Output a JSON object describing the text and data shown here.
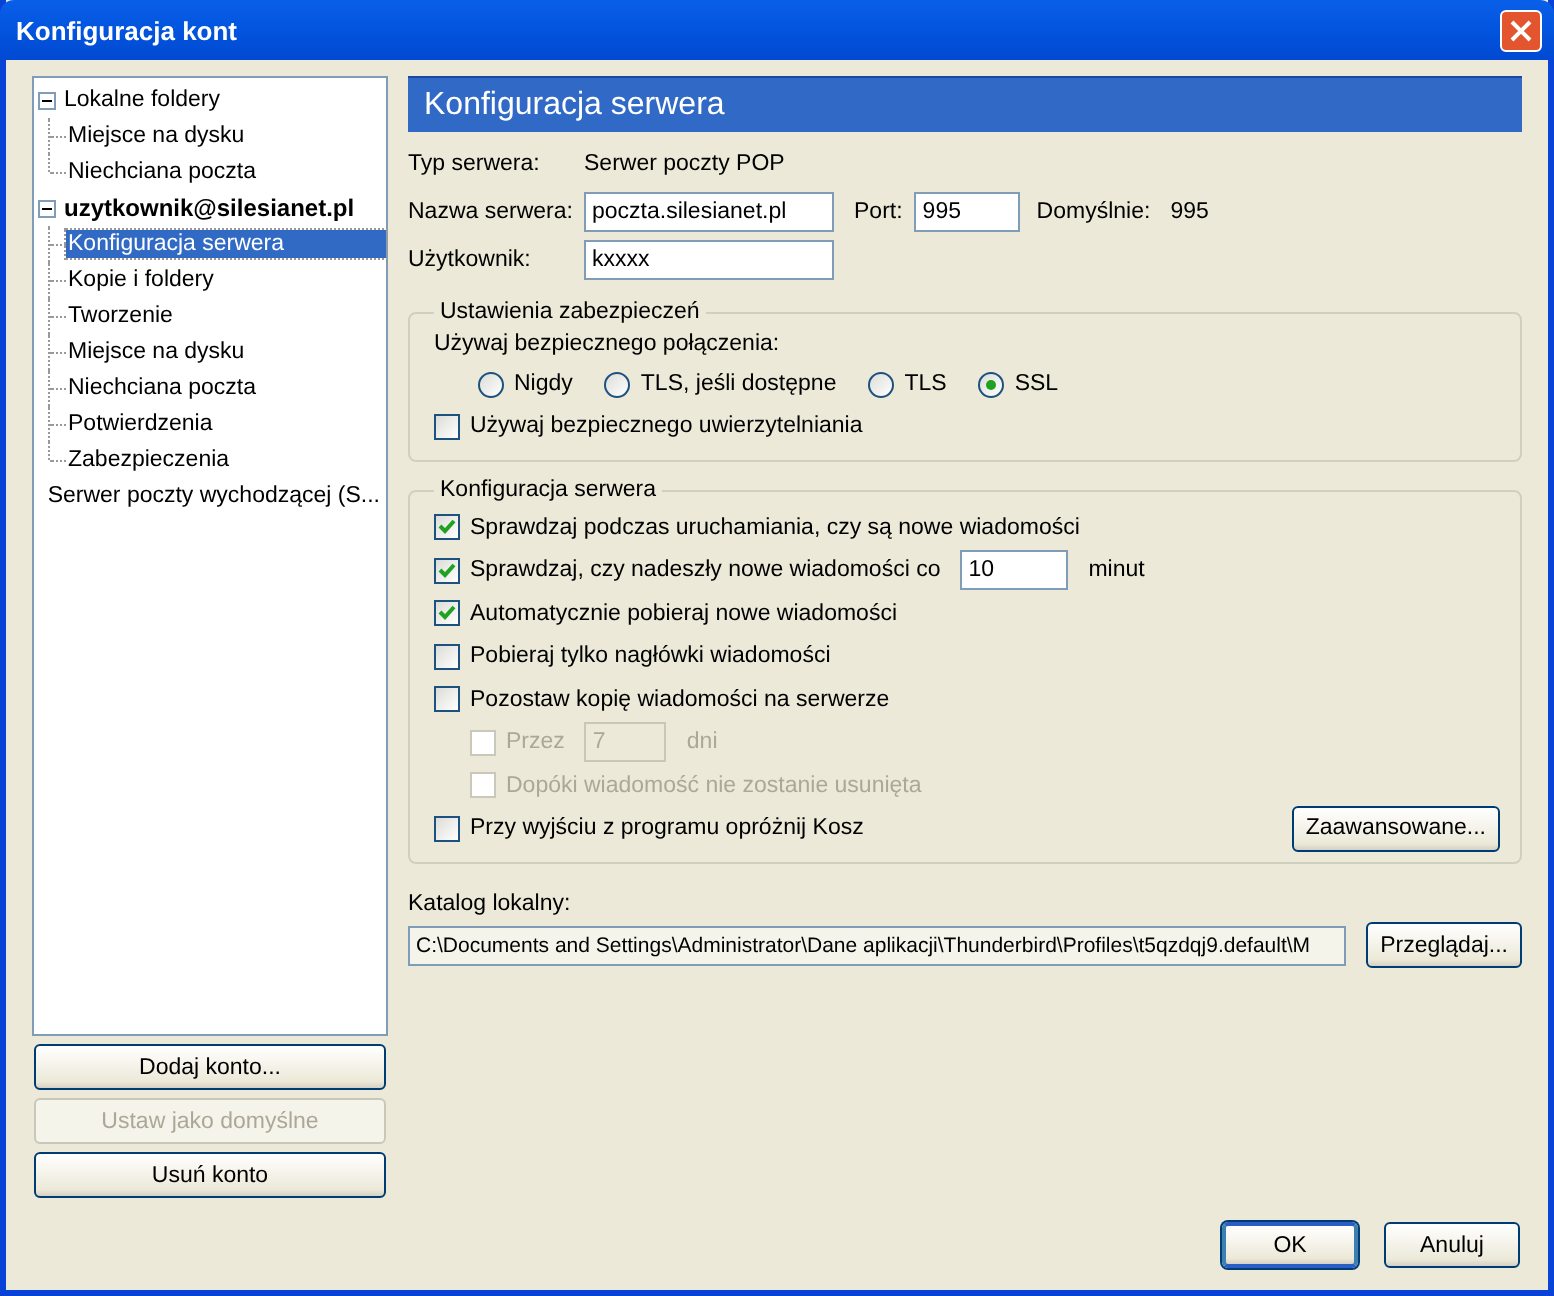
{
  "window": {
    "title": "Konfiguracja kont"
  },
  "tree": [
    {
      "label": "Lokalne foldery",
      "kind": "folder",
      "expanded": true,
      "selected": false,
      "children": [
        {
          "label": "Miejsce na dysku",
          "selected": false
        },
        {
          "label": "Niechciana poczta",
          "selected": false
        }
      ]
    },
    {
      "label": "uzytkownik@silesianet.pl",
      "kind": "account",
      "expanded": true,
      "selected": false,
      "children": [
        {
          "label": "Konfiguracja serwera",
          "selected": true
        },
        {
          "label": "Kopie i foldery",
          "selected": false
        },
        {
          "label": "Tworzenie",
          "selected": false
        },
        {
          "label": "Miejsce na dysku",
          "selected": false
        },
        {
          "label": "Niechciana poczta",
          "selected": false
        },
        {
          "label": "Potwierdzenia",
          "selected": false
        },
        {
          "label": "Zabezpieczenia",
          "selected": false
        }
      ]
    },
    {
      "label": "Serwer poczty wychodzącej (S...",
      "kind": "folder",
      "selected": false
    }
  ],
  "account_buttons": [
    {
      "label": "Dodaj konto...",
      "disabled": false
    },
    {
      "label": "Ustaw jako domyślne",
      "disabled": true
    },
    {
      "label": "Usuń konto",
      "disabled": false
    }
  ],
  "panel": {
    "title": "Konfiguracja serwera",
    "server_type": {
      "label": "Typ serwera:",
      "value": "Serwer poczty POP"
    },
    "server_name": {
      "label": "Nazwa serwera:",
      "value": "poczta.silesianet.pl"
    },
    "port": {
      "label": "Port:",
      "value": "995"
    },
    "default_port": {
      "label": "Domyślnie:",
      "value": "995"
    },
    "user": {
      "label": "Użytkownik:",
      "value": "kxxxx"
    },
    "security": {
      "title": "Ustawienia zabezpieczeń",
      "prompt": "Używaj bezpiecznego połączenia:",
      "radios": [
        {
          "label": "Nigdy",
          "selected": false
        },
        {
          "label": "TLS, jeśli dostępne",
          "selected": false
        },
        {
          "label": "TLS",
          "selected": false
        },
        {
          "label": "SSL",
          "selected": true
        }
      ],
      "secure_auth": {
        "label": "Używaj bezpiecznego uwierzytelniania",
        "checked": false
      }
    },
    "server": {
      "title": "Konfiguracja serwera",
      "options": [
        {
          "kind": "check",
          "label": "Sprawdzaj podczas uruchamiania, czy są nowe wiadomości",
          "checked": true,
          "disabled": false
        },
        {
          "kind": "interval",
          "label": "Sprawdzaj, czy nadeszły nowe wiadomości co",
          "checked": true,
          "disabled": false,
          "value": "10",
          "unit": "minut"
        },
        {
          "kind": "check",
          "label": "Automatycznie pobieraj nowe wiadomości",
          "checked": true,
          "disabled": false
        },
        {
          "kind": "check",
          "label": "Pobieraj tylko nagłówki wiadomości",
          "checked": false,
          "disabled": false
        },
        {
          "kind": "check",
          "label": "Pozostaw kopię wiadomości na serwerze",
          "checked": false,
          "disabled": false,
          "children": [
            {
              "kind": "interval",
              "label": "Przez",
              "checked": false,
              "disabled": true,
              "value": "7",
              "unit": "dni"
            },
            {
              "kind": "check",
              "label": "Dopóki wiadomość nie zostanie usunięta",
              "checked": false,
              "disabled": true
            }
          ]
        }
      ],
      "empty_trash": {
        "label": "Przy wyjściu z programu opróżnij Kosz",
        "checked": false
      },
      "advanced_button": "Zaawansowane..."
    },
    "local_dir": {
      "label": "Katalog lokalny:",
      "value": "C:\\Documents and Settings\\Administrator\\Dane aplikacji\\Thunderbird\\Profiles\\t5qzdqj9.default\\M",
      "button": "Przeglądaj..."
    }
  },
  "dialog_buttons": [
    "OK",
    "Anuluj"
  ]
}
